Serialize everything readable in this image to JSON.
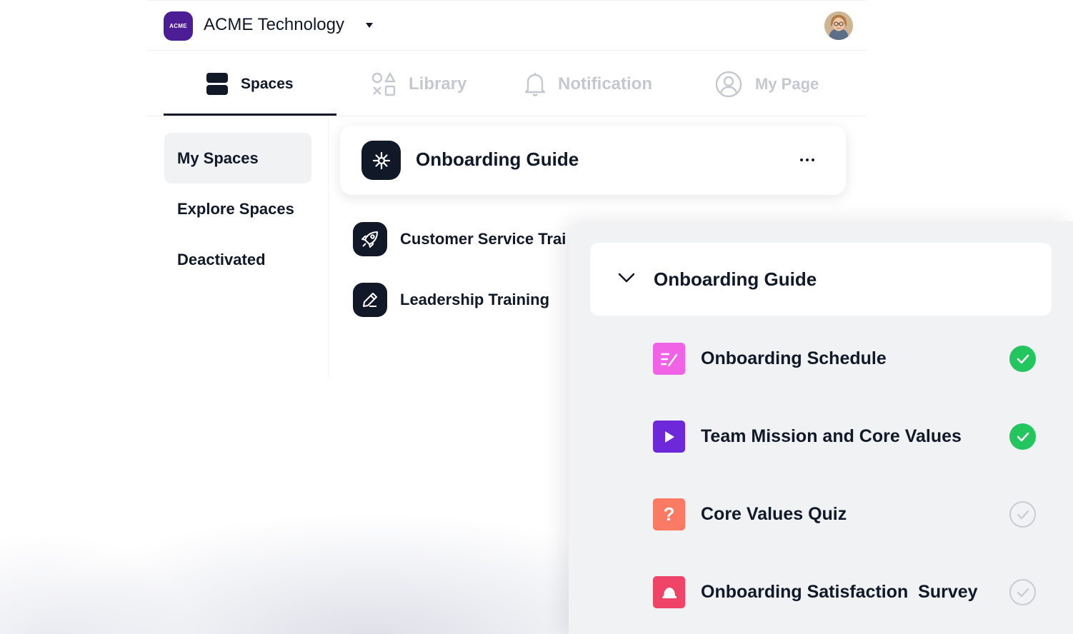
{
  "header": {
    "org_logo_text": "ACME",
    "org_name": "ACME Technology"
  },
  "nav": {
    "tabs": [
      {
        "label": "Spaces",
        "icon": "spaces-icon",
        "active": true
      },
      {
        "label": "Library",
        "icon": "library-icon",
        "active": false
      },
      {
        "label": "Notification",
        "icon": "bell-icon",
        "active": false
      },
      {
        "label": "My Page",
        "icon": "user-icon",
        "active": false
      }
    ]
  },
  "sidebar": {
    "items": [
      {
        "label": "My Spaces",
        "active": true
      },
      {
        "label": "Explore Spaces",
        "active": false
      },
      {
        "label": "Deactivated",
        "active": false
      }
    ]
  },
  "space": {
    "title": "Onboarding Guide",
    "icon": "sparkle-icon",
    "courses": [
      {
        "label": "Customer Service Trai",
        "icon": "rocket-icon"
      },
      {
        "label": "Leadership Training",
        "icon": "pencil-icon"
      }
    ]
  },
  "panel": {
    "title": "Onboarding Guide",
    "lessons": [
      {
        "label": "Onboarding Schedule",
        "icon": "document-edit-icon",
        "icon_color": "#f062e6",
        "completed": true
      },
      {
        "label": "Team Mission and Core Values",
        "icon": "play-icon",
        "icon_color": "#6d28d9",
        "completed": true
      },
      {
        "label": "Core Values Quiz",
        "icon": "question-icon",
        "icon_symbol": "?",
        "icon_color": "#fb7a63",
        "completed": false
      },
      {
        "label": "Onboarding Satisfaction  Survey",
        "icon": "survey-icon",
        "icon_color": "#ef4467",
        "completed": false
      }
    ]
  },
  "colors": {
    "brand": "#4c1d95",
    "dark": "#111827",
    "success": "#22c55e",
    "inactive_text": "#c5c8ce"
  }
}
